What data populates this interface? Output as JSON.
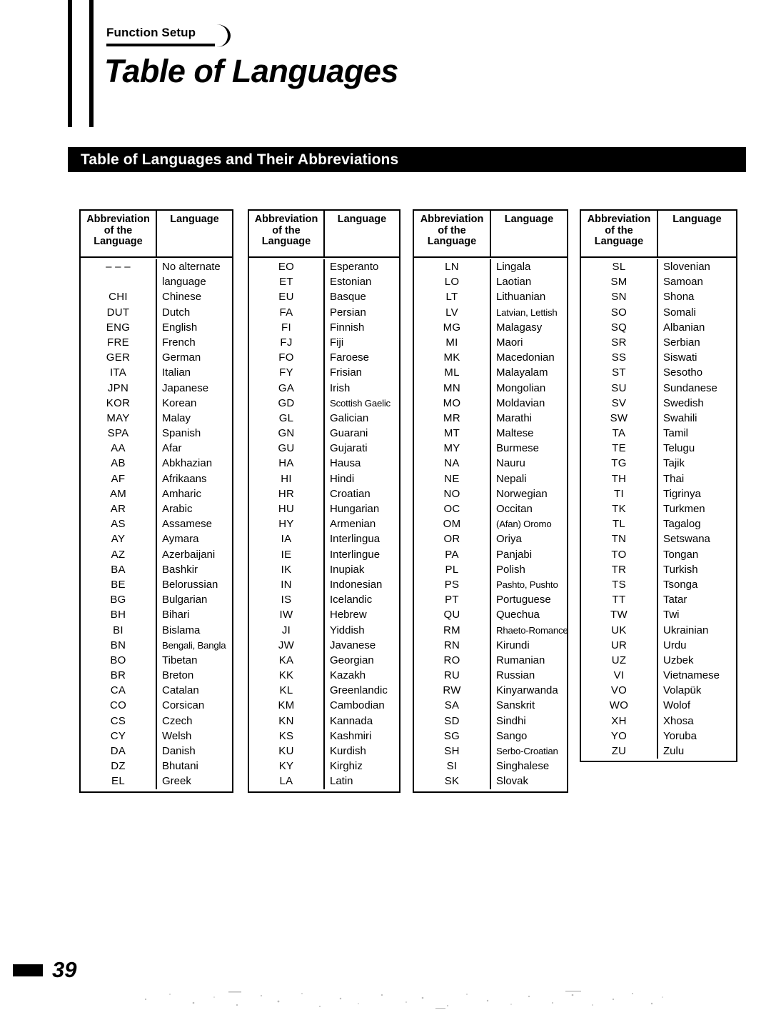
{
  "header": {
    "section_tab_label": "Function Setup",
    "page_title": "Table of Languages",
    "banner_title": "Table of Languages and Their Abbreviations"
  },
  "table": {
    "column_headers": {
      "abbreviation_line1": "Abbreviation",
      "abbreviation_line2": "of the",
      "abbreviation_line3": "Language",
      "language": "Language"
    },
    "blocks": [
      {
        "id": "block-1",
        "rows": [
          {
            "abbr": "– – –",
            "lang": "No alternate"
          },
          {
            "abbr": "",
            "lang": "language"
          },
          {
            "abbr": "CHI",
            "lang": "Chinese"
          },
          {
            "abbr": "DUT",
            "lang": "Dutch"
          },
          {
            "abbr": "ENG",
            "lang": "English"
          },
          {
            "abbr": "FRE",
            "lang": "French"
          },
          {
            "abbr": "GER",
            "lang": "German"
          },
          {
            "abbr": "ITA",
            "lang": "Italian"
          },
          {
            "abbr": "JPN",
            "lang": "Japanese"
          },
          {
            "abbr": "KOR",
            "lang": "Korean"
          },
          {
            "abbr": "MAY",
            "lang": "Malay"
          },
          {
            "abbr": "SPA",
            "lang": "Spanish"
          },
          {
            "abbr": "AA",
            "lang": "Afar"
          },
          {
            "abbr": "AB",
            "lang": "Abkhazian"
          },
          {
            "abbr": "AF",
            "lang": "Afrikaans"
          },
          {
            "abbr": "AM",
            "lang": "Amharic"
          },
          {
            "abbr": "AR",
            "lang": "Arabic"
          },
          {
            "abbr": "AS",
            "lang": "Assamese"
          },
          {
            "abbr": "AY",
            "lang": "Aymara"
          },
          {
            "abbr": "AZ",
            "lang": "Azerbaijani"
          },
          {
            "abbr": "BA",
            "lang": "Bashkir"
          },
          {
            "abbr": "BE",
            "lang": "Belorussian"
          },
          {
            "abbr": "BG",
            "lang": "Bulgarian"
          },
          {
            "abbr": "BH",
            "lang": "Bihari"
          },
          {
            "abbr": "BI",
            "lang": "Bislama"
          },
          {
            "abbr": "BN",
            "lang": "Bengali, Bangla",
            "tight": true
          },
          {
            "abbr": "BO",
            "lang": "Tibetan"
          },
          {
            "abbr": "BR",
            "lang": "Breton"
          },
          {
            "abbr": "CA",
            "lang": "Catalan"
          },
          {
            "abbr": "CO",
            "lang": "Corsican"
          },
          {
            "abbr": "CS",
            "lang": "Czech"
          },
          {
            "abbr": "CY",
            "lang": "Welsh"
          },
          {
            "abbr": "DA",
            "lang": "Danish"
          },
          {
            "abbr": "DZ",
            "lang": "Bhutani"
          },
          {
            "abbr": "EL",
            "lang": "Greek"
          }
        ]
      },
      {
        "id": "block-2",
        "rows": [
          {
            "abbr": "EO",
            "lang": "Esperanto"
          },
          {
            "abbr": "ET",
            "lang": "Estonian"
          },
          {
            "abbr": "EU",
            "lang": "Basque"
          },
          {
            "abbr": "FA",
            "lang": "Persian"
          },
          {
            "abbr": "FI",
            "lang": "Finnish"
          },
          {
            "abbr": "FJ",
            "lang": "Fiji"
          },
          {
            "abbr": "FO",
            "lang": "Faroese"
          },
          {
            "abbr": "FY",
            "lang": "Frisian"
          },
          {
            "abbr": "GA",
            "lang": "Irish"
          },
          {
            "abbr": "GD",
            "lang": "Scottish Gaelic",
            "tight": true
          },
          {
            "abbr": "GL",
            "lang": "Galician"
          },
          {
            "abbr": "GN",
            "lang": "Guarani"
          },
          {
            "abbr": "GU",
            "lang": "Gujarati"
          },
          {
            "abbr": "HA",
            "lang": "Hausa"
          },
          {
            "abbr": "HI",
            "lang": "Hindi"
          },
          {
            "abbr": "HR",
            "lang": "Croatian"
          },
          {
            "abbr": "HU",
            "lang": "Hungarian"
          },
          {
            "abbr": "HY",
            "lang": "Armenian"
          },
          {
            "abbr": "IA",
            "lang": "Interlingua"
          },
          {
            "abbr": "IE",
            "lang": "Interlingue"
          },
          {
            "abbr": "IK",
            "lang": "Inupiak"
          },
          {
            "abbr": "IN",
            "lang": "Indonesian"
          },
          {
            "abbr": "IS",
            "lang": "Icelandic"
          },
          {
            "abbr": "IW",
            "lang": "Hebrew"
          },
          {
            "abbr": "JI",
            "lang": "Yiddish"
          },
          {
            "abbr": "JW",
            "lang": "Javanese"
          },
          {
            "abbr": "KA",
            "lang": "Georgian"
          },
          {
            "abbr": "KK",
            "lang": "Kazakh"
          },
          {
            "abbr": "KL",
            "lang": "Greenlandic"
          },
          {
            "abbr": "KM",
            "lang": "Cambodian"
          },
          {
            "abbr": "KN",
            "lang": "Kannada"
          },
          {
            "abbr": "KS",
            "lang": "Kashmiri"
          },
          {
            "abbr": "KU",
            "lang": "Kurdish"
          },
          {
            "abbr": "KY",
            "lang": "Kirghiz"
          },
          {
            "abbr": "LA",
            "lang": "Latin"
          }
        ]
      },
      {
        "id": "block-3",
        "rows": [
          {
            "abbr": "LN",
            "lang": "Lingala"
          },
          {
            "abbr": "LO",
            "lang": "Laotian"
          },
          {
            "abbr": "LT",
            "lang": "Lithuanian"
          },
          {
            "abbr": "LV",
            "lang": "Latvian, Lettish",
            "tight": true
          },
          {
            "abbr": "MG",
            "lang": "Malagasy"
          },
          {
            "abbr": "MI",
            "lang": "Maori"
          },
          {
            "abbr": "MK",
            "lang": "Macedonian"
          },
          {
            "abbr": "ML",
            "lang": "Malayalam"
          },
          {
            "abbr": "MN",
            "lang": "Mongolian"
          },
          {
            "abbr": "MO",
            "lang": "Moldavian"
          },
          {
            "abbr": "MR",
            "lang": "Marathi"
          },
          {
            "abbr": "MT",
            "lang": "Maltese"
          },
          {
            "abbr": "MY",
            "lang": "Burmese"
          },
          {
            "abbr": "NA",
            "lang": "Nauru"
          },
          {
            "abbr": "NE",
            "lang": "Nepali"
          },
          {
            "abbr": "NO",
            "lang": "Norwegian"
          },
          {
            "abbr": "OC",
            "lang": "Occitan"
          },
          {
            "abbr": "OM",
            "lang": "(Afan) Oromo",
            "tight": true
          },
          {
            "abbr": "OR",
            "lang": "Oriya"
          },
          {
            "abbr": "PA",
            "lang": "Panjabi"
          },
          {
            "abbr": "PL",
            "lang": "Polish"
          },
          {
            "abbr": "PS",
            "lang": "Pashto, Pushto",
            "tight": true
          },
          {
            "abbr": "PT",
            "lang": "Portuguese"
          },
          {
            "abbr": "QU",
            "lang": "Quechua"
          },
          {
            "abbr": "RM",
            "lang": "Rhaeto-Romance",
            "tight": true
          },
          {
            "abbr": "RN",
            "lang": "Kirundi"
          },
          {
            "abbr": "RO",
            "lang": "Rumanian"
          },
          {
            "abbr": "RU",
            "lang": "Russian"
          },
          {
            "abbr": "RW",
            "lang": "Kinyarwanda"
          },
          {
            "abbr": "SA",
            "lang": "Sanskrit"
          },
          {
            "abbr": "SD",
            "lang": "Sindhi"
          },
          {
            "abbr": "SG",
            "lang": "Sango"
          },
          {
            "abbr": "SH",
            "lang": "Serbo-Croatian",
            "tight": true
          },
          {
            "abbr": "SI",
            "lang": "Singhalese"
          },
          {
            "abbr": "SK",
            "lang": "Slovak"
          }
        ]
      },
      {
        "id": "block-4",
        "rows": [
          {
            "abbr": "SL",
            "lang": "Slovenian"
          },
          {
            "abbr": "SM",
            "lang": "Samoan"
          },
          {
            "abbr": "SN",
            "lang": "Shona"
          },
          {
            "abbr": "SO",
            "lang": "Somali"
          },
          {
            "abbr": "SQ",
            "lang": "Albanian"
          },
          {
            "abbr": "SR",
            "lang": "Serbian"
          },
          {
            "abbr": "SS",
            "lang": "Siswati"
          },
          {
            "abbr": "ST",
            "lang": "Sesotho"
          },
          {
            "abbr": "SU",
            "lang": "Sundanese"
          },
          {
            "abbr": "SV",
            "lang": "Swedish"
          },
          {
            "abbr": "SW",
            "lang": "Swahili"
          },
          {
            "abbr": "TA",
            "lang": "Tamil"
          },
          {
            "abbr": "TE",
            "lang": "Telugu"
          },
          {
            "abbr": "TG",
            "lang": "Tajik"
          },
          {
            "abbr": "TH",
            "lang": "Thai"
          },
          {
            "abbr": "TI",
            "lang": "Tigrinya"
          },
          {
            "abbr": "TK",
            "lang": "Turkmen"
          },
          {
            "abbr": "TL",
            "lang": "Tagalog"
          },
          {
            "abbr": "TN",
            "lang": "Setswana"
          },
          {
            "abbr": "TO",
            "lang": "Tongan"
          },
          {
            "abbr": "TR",
            "lang": "Turkish"
          },
          {
            "abbr": "TS",
            "lang": "Tsonga"
          },
          {
            "abbr": "TT",
            "lang": "Tatar"
          },
          {
            "abbr": "TW",
            "lang": "Twi"
          },
          {
            "abbr": "UK",
            "lang": "Ukrainian"
          },
          {
            "abbr": "UR",
            "lang": "Urdu"
          },
          {
            "abbr": "UZ",
            "lang": "Uzbek"
          },
          {
            "abbr": "VI",
            "lang": "Vietnamese"
          },
          {
            "abbr": "VO",
            "lang": "Volapük"
          },
          {
            "abbr": "WO",
            "lang": "Wolof"
          },
          {
            "abbr": "XH",
            "lang": "Xhosa"
          },
          {
            "abbr": "YO",
            "lang": "Yoruba"
          },
          {
            "abbr": "ZU",
            "lang": "Zulu"
          }
        ]
      }
    ]
  },
  "footer": {
    "page_number": "39"
  },
  "colors": {
    "ink": "#000000",
    "paper": "#ffffff",
    "banner_bg": "#000000",
    "banner_text": "#ffffff"
  }
}
